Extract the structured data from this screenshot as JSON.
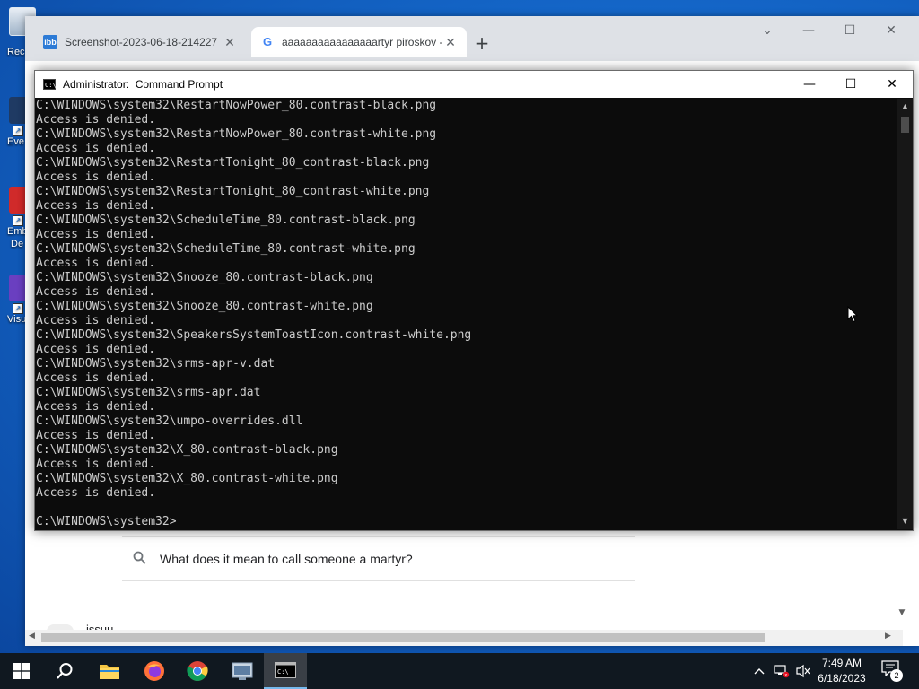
{
  "desktop": {
    "icons": [
      {
        "label": "Rec",
        "label2": ""
      },
      {
        "label": "Eve",
        "label2": ""
      },
      {
        "label": "Emb",
        "label2": "De"
      },
      {
        "label": "Visu",
        "label2": ""
      }
    ]
  },
  "chrome": {
    "tabs": [
      {
        "title": "Screenshot-2023-06-18-214227",
        "favicon": "ibb",
        "close": "✕"
      },
      {
        "title": "aaaaaaaaaaaaaaaartyr piroskov -",
        "favicon": "G",
        "close": "✕"
      }
    ],
    "new_tab": "+",
    "window_controls": {
      "dropdown": "⌄",
      "minimize": "—",
      "maximize": "☐",
      "close": "✕"
    },
    "page": {
      "related_search": "What does it mean to call someone a martyr?",
      "partial_text": "issuu"
    }
  },
  "cmd": {
    "title": "Administrator:  Command Prompt",
    "icon_text": "C:\\",
    "controls": {
      "minimize": "—",
      "maximize": "☐",
      "close": "✕"
    },
    "lines": [
      "C:\\WINDOWS\\system32\\RestartNowPower_80.contrast-black.png",
      "Access is denied.",
      "C:\\WINDOWS\\system32\\RestartNowPower_80.contrast-white.png",
      "Access is denied.",
      "C:\\WINDOWS\\system32\\RestartTonight_80_contrast-black.png",
      "Access is denied.",
      "C:\\WINDOWS\\system32\\RestartTonight_80_contrast-white.png",
      "Access is denied.",
      "C:\\WINDOWS\\system32\\ScheduleTime_80.contrast-black.png",
      "Access is denied.",
      "C:\\WINDOWS\\system32\\ScheduleTime_80.contrast-white.png",
      "Access is denied.",
      "C:\\WINDOWS\\system32\\Snooze_80.contrast-black.png",
      "Access is denied.",
      "C:\\WINDOWS\\system32\\Snooze_80.contrast-white.png",
      "Access is denied.",
      "C:\\WINDOWS\\system32\\SpeakersSystemToastIcon.contrast-white.png",
      "Access is denied.",
      "C:\\WINDOWS\\system32\\srms-apr-v.dat",
      "Access is denied.",
      "C:\\WINDOWS\\system32\\srms-apr.dat",
      "Access is denied.",
      "C:\\WINDOWS\\system32\\umpo-overrides.dll",
      "Access is denied.",
      "C:\\WINDOWS\\system32\\X_80.contrast-black.png",
      "Access is denied.",
      "C:\\WINDOWS\\system32\\X_80.contrast-white.png",
      "Access is denied.",
      "",
      "C:\\WINDOWS\\system32>"
    ]
  },
  "taskbar": {
    "clock_time": "7:49 AM",
    "clock_date": "6/18/2023",
    "notification_count": "2",
    "accent_color": "#76b9ed"
  }
}
